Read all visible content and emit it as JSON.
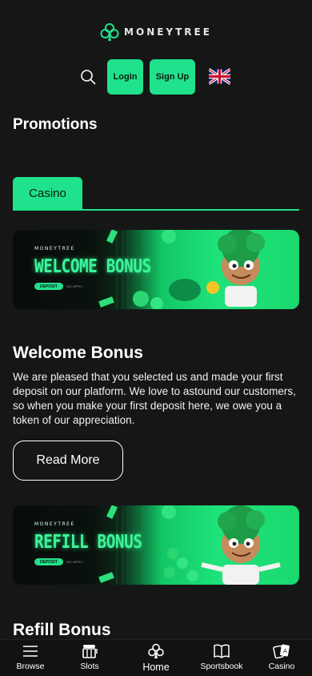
{
  "header": {
    "logo_text": "MONEYTREE",
    "login_label": "Login",
    "signup_label": "Sign Up"
  },
  "page": {
    "title": "Promotions",
    "tabs": [
      {
        "label": "Casino"
      }
    ]
  },
  "promotions": [
    {
      "banner_brand": "MONEYTREE",
      "banner_title": "WELCOME BONUS",
      "banner_cta": "DEPOSIT",
      "banner_tc": "T&C APPLY",
      "title": "Welcome Bonus",
      "description": "We are pleased that you selected us and made your first deposit on our platform. We love to astound our customers, so when you make your first deposit here, we owe you a token of our appreciation.",
      "button_label": "Read More"
    },
    {
      "banner_brand": "MONEYTREE",
      "banner_title": "REFILL BONUS",
      "banner_cta": "DEPOSIT",
      "banner_tc": "T&C APPLY",
      "title": "Refill Bonus"
    }
  ],
  "bottom_nav": [
    {
      "label": "Browse",
      "icon": "menu-icon"
    },
    {
      "label": "Slots",
      "icon": "slot-machine-icon"
    },
    {
      "label": "Home",
      "icon": "club-icon"
    },
    {
      "label": "Sportsbook",
      "icon": "book-icon"
    },
    {
      "label": "Casino",
      "icon": "cards-icon"
    }
  ],
  "colors": {
    "accent": "#20e28c",
    "background": "#151717"
  }
}
